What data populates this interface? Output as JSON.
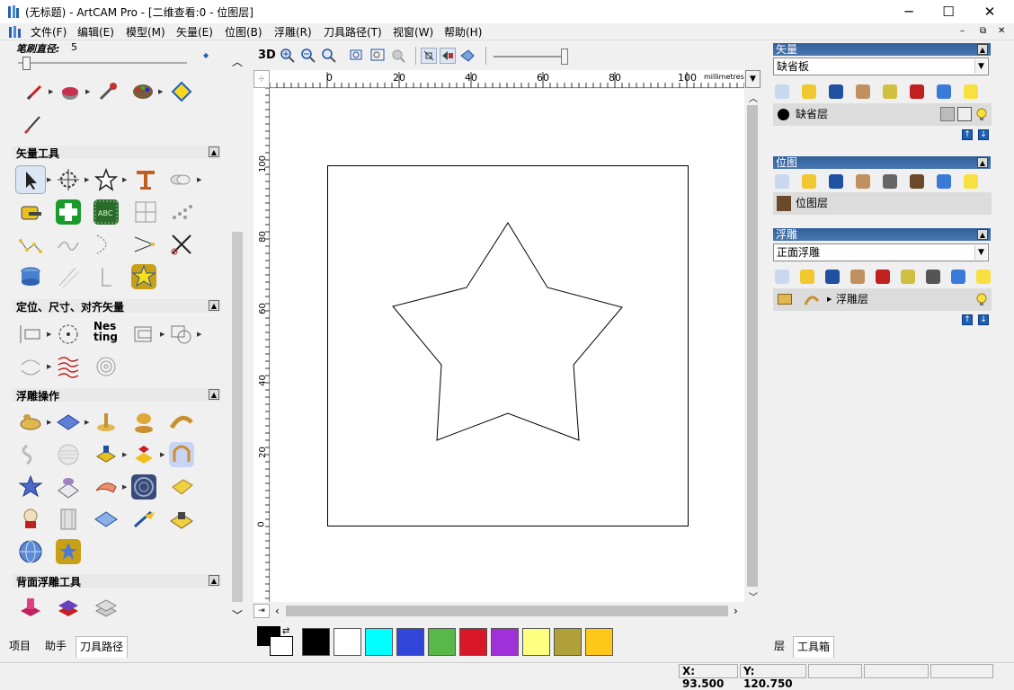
{
  "window": {
    "title": "(无标题) - ArtCAM Pro - [二维查看:0 - 位图层]"
  },
  "menu": [
    "文件(F)",
    "编辑(E)",
    "模型(M)",
    "矢量(E)",
    "位图(B)",
    "浮雕(R)",
    "刀具路径(T)",
    "视窗(W)",
    "帮助(H)"
  ],
  "brush": {
    "label": "笔刷直径:",
    "value": "5"
  },
  "sections": {
    "vector_tools": "矢量工具",
    "position_tools": "定位、尺寸、对齐矢量",
    "relief_ops": "浮雕操作",
    "back_relief": "背面浮雕工具"
  },
  "nesting_label": "Nes\nting",
  "left_tabs": [
    "项目",
    "助手",
    "刀具路径"
  ],
  "view": {
    "mode_3d": "3D",
    "units": "millimetres"
  },
  "ruler": {
    "x_ticks": [
      "0",
      "20",
      "40",
      "60",
      "80",
      "100"
    ],
    "y_ticks": [
      "100",
      "80",
      "60",
      "40",
      "20",
      "0"
    ]
  },
  "palette": [
    "#000000",
    "#ffffff",
    "#00ffff",
    "#3046d8",
    "#58b848",
    "#d81828",
    "#a030d8",
    "#ffff80",
    "#b0a038",
    "#ffc818"
  ],
  "right": {
    "vector": {
      "header": "矢量",
      "combo": "缺省板",
      "layer": "缺省层"
    },
    "bitmap": {
      "header": "位图",
      "layer": "位图层"
    },
    "relief": {
      "header": "浮雕",
      "combo": "正面浮雕",
      "layer": "浮雕层"
    },
    "tabs": [
      "层",
      "工具箱"
    ]
  },
  "status": {
    "x": "X: 93.500",
    "y": "Y: 120.750"
  }
}
